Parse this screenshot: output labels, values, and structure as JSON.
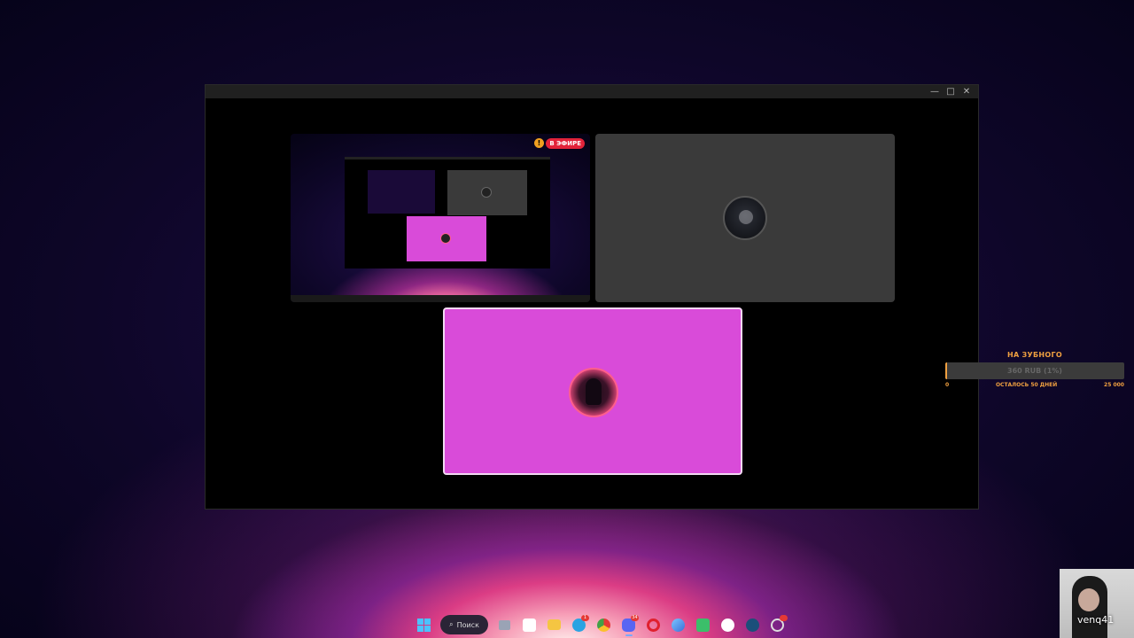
{
  "window": {
    "controls": {
      "minimize": "—",
      "maximize": "□",
      "close": "✕"
    }
  },
  "tiles": {
    "share": {
      "live_badge": "В ЭФИРЕ",
      "warning_icon": "warning-icon"
    },
    "camera": {
      "avatar_icon": "user-avatar"
    },
    "speaker": {
      "avatar_icon": "user-avatar"
    }
  },
  "goal": {
    "title": "НА ЗУБНОГО",
    "amount": "360 RUB (1%)",
    "progress_percent": 1,
    "min": "0",
    "remaining": "ОСТАЛОСЬ 50 ДНЕЙ",
    "max": "25 000",
    "accent_color": "#f0a040"
  },
  "webcam": {
    "name": "venq41"
  },
  "taskbar": {
    "search_label": "Поиск",
    "apps": [
      "start-icon",
      "task-view-icon",
      "store-icon",
      "file-explorer-icon",
      "telegram-icon",
      "chrome-icon",
      "discord-icon",
      "opera-icon",
      "browser-icon",
      "game-icon",
      "yandex-icon",
      "steam-icon",
      "obs-icon"
    ]
  },
  "colors": {
    "speaker_tile": "#d94bd9",
    "camera_tile": "#3a3a3a",
    "live_badge": "#e2233a"
  }
}
